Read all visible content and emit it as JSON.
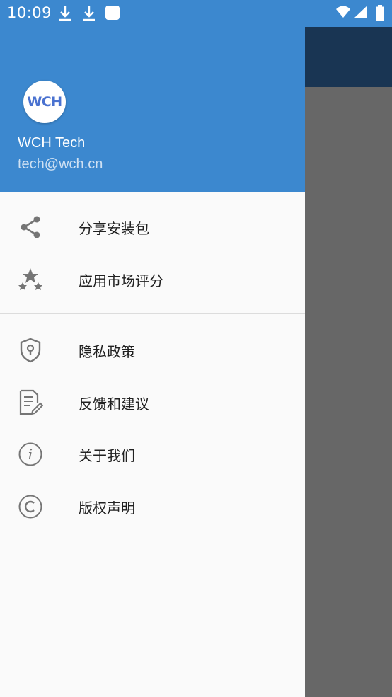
{
  "status_bar": {
    "time": "10:09",
    "notification_icons": [
      "download-icon",
      "download-icon",
      "app-notification-icon"
    ],
    "system_icons": [
      "wifi-icon",
      "signal-icon",
      "battery-icon"
    ]
  },
  "drawer": {
    "header": {
      "avatar_text": "WCH",
      "name": "WCH Tech",
      "email": "tech@wch.cn"
    },
    "primary_items": [
      {
        "label": "分享安装包",
        "icon": "share-icon"
      },
      {
        "label": "应用市场评分",
        "icon": "stars-icon"
      }
    ],
    "secondary_items": [
      {
        "label": "隐私政策",
        "icon": "privacy-shield-icon"
      },
      {
        "label": "反馈和建议",
        "icon": "feedback-icon"
      },
      {
        "label": "关于我们",
        "icon": "info-icon"
      },
      {
        "label": "版权声明",
        "icon": "copyright-icon"
      }
    ]
  },
  "colors": {
    "header": "#3c88cf",
    "app_toolbar": "#193553",
    "scrim": "#676767",
    "icon": "#757575",
    "text": "#212121"
  }
}
